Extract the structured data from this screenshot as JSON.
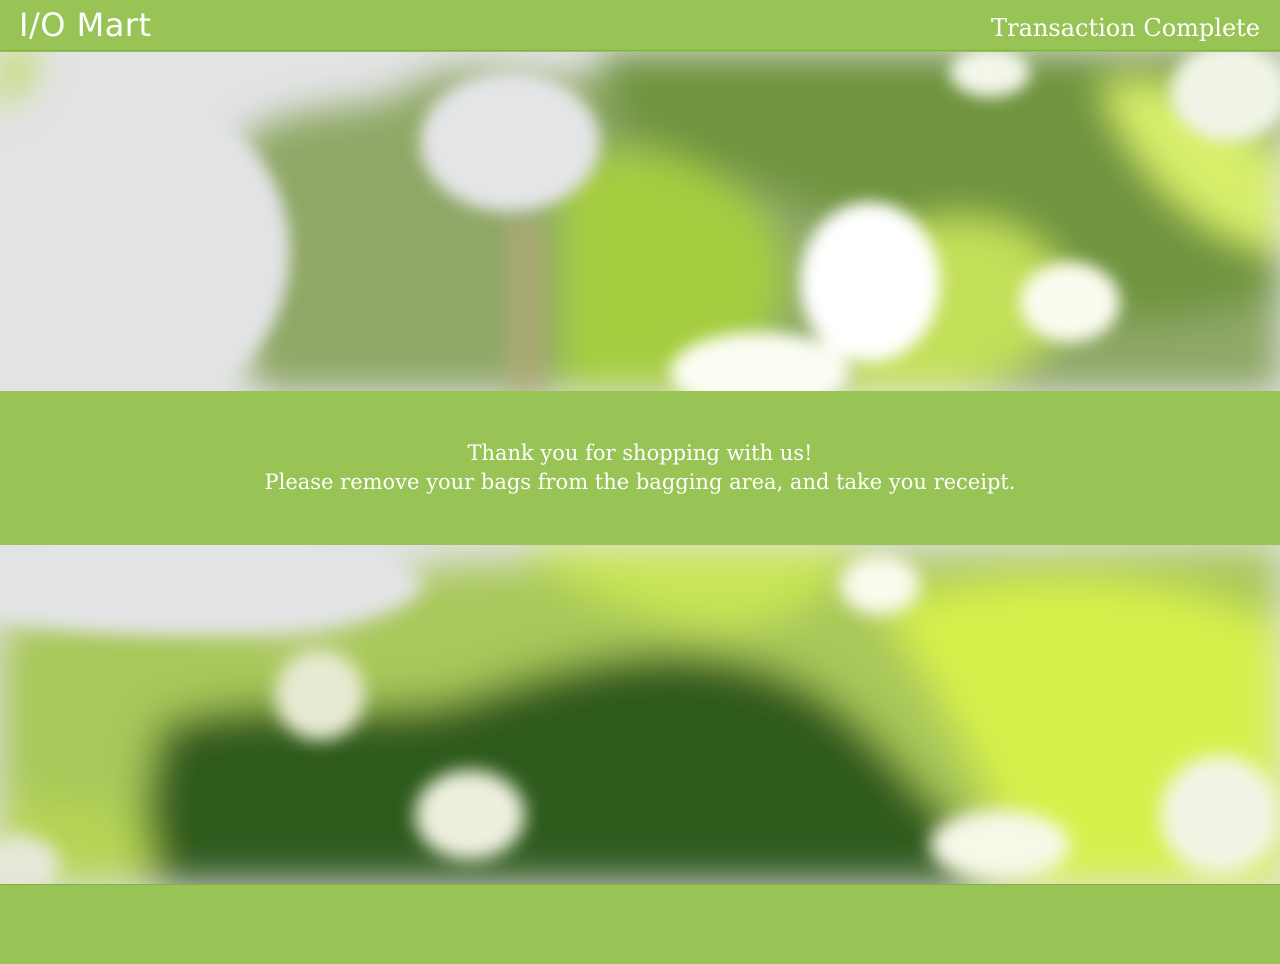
{
  "header": {
    "brand": "I/O Mart",
    "status": "Transaction Complete"
  },
  "message": {
    "line1": "Thank you for shopping with us!",
    "line2": "Please remove your bags from the bagging area, and take you receipt."
  },
  "colors": {
    "accent": "#97c455",
    "text": "#ffffff"
  },
  "images": {
    "top": "blurred-green-leaves-photo",
    "bottom": "blurred-green-leaves-photo"
  }
}
